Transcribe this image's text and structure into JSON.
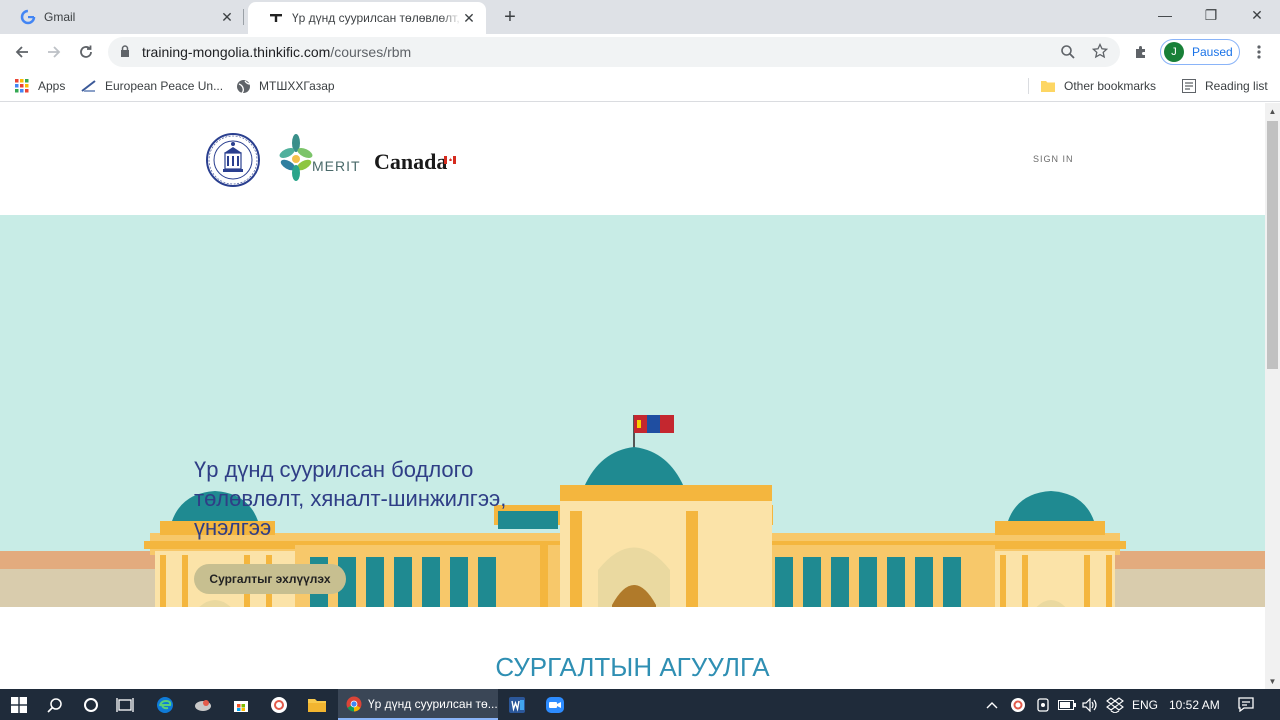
{
  "browser": {
    "tabs": [
      {
        "title": "Gmail",
        "favicon": "google-g-icon",
        "active": false
      },
      {
        "title": "Үр дүнд суурилсан төлөвлөлт, х",
        "favicon": "thinkific-icon",
        "active": true
      }
    ],
    "new_tab": "+",
    "window_controls": {
      "minimize": "—",
      "restore": "❐",
      "close": "✕"
    },
    "url_host": "training-mongolia.thinkific.com",
    "url_path": "/courses/rbm",
    "profile_initial": "J",
    "profile_status": "Paused",
    "bookmarks": [
      {
        "label": "Apps",
        "icon": "apps-grid-icon"
      },
      {
        "label": "European Peace Un...",
        "icon": "bookmark-site-icon"
      },
      {
        "label": "МТШХХГазар",
        "icon": "globe-icon"
      }
    ],
    "other_bookmarks": "Other bookmarks",
    "reading_list": "Reading list"
  },
  "site": {
    "logo_text_merit": "MERIT",
    "logo_text_canada": "Canada",
    "nav_sign_in": "SIGN IN",
    "hero_title": "Үр дүнд суурилсан бодлого төлөвлөлт, хяналт-шинжилгээ, үнэлгээ",
    "hero_button": "Сургалтыг эхлүүлэх",
    "section_title": "СУРГАЛТЫН АГУУЛГА"
  },
  "taskbar": {
    "active_task": "Үр дүнд суурилсан тө...",
    "language": "ENG",
    "time": "10:52 AM"
  },
  "colors": {
    "hero_bg": "#c8ece6",
    "hero_title": "#2f3e86",
    "section_title": "#2f8fb3",
    "building_yellow": "#f7c86a",
    "building_teal": "#1f8a91"
  }
}
